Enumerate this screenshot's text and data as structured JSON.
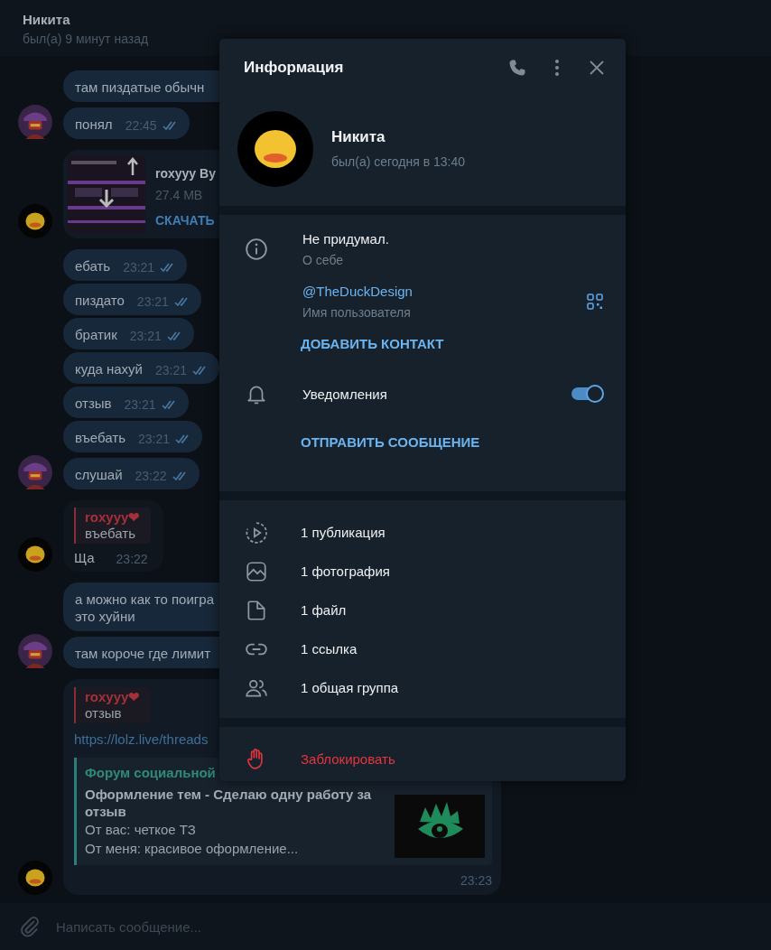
{
  "chat_header": {
    "name": "Никита",
    "status": "был(а) 9 минут назад"
  },
  "messages": [
    {
      "kind": "text",
      "text": "там пиздатые обычн"
    },
    {
      "kind": "text",
      "avatar": {
        "kind": "figure"
      },
      "text": "понял",
      "time": "22:45",
      "read": true
    },
    {
      "kind": "file",
      "avatar": {
        "kind": "duck"
      },
      "name": "roxyyy By",
      "size": "27.4 MB",
      "action": "СКАЧАТЬ"
    },
    {
      "kind": "text",
      "text": "ебать",
      "time": "23:21",
      "read": true
    },
    {
      "kind": "text",
      "text": "пиздато",
      "time": "23:21",
      "read": true
    },
    {
      "kind": "text",
      "text": "братик",
      "time": "23:21",
      "read": true
    },
    {
      "kind": "text",
      "text": "куда нахуй",
      "time": "23:21",
      "read": true
    },
    {
      "kind": "text",
      "text": "отзыв",
      "time": "23:21",
      "read": true
    },
    {
      "kind": "text",
      "text": "въебать",
      "time": "23:21",
      "read": true
    },
    {
      "kind": "text",
      "avatar": {
        "kind": "figure"
      },
      "text": "слушай",
      "time": "23:22",
      "read": true
    },
    {
      "kind": "reply",
      "avatar": {
        "kind": "duck"
      },
      "quote_author": "roxyyy❤",
      "quote_text": "въебать",
      "text": "Ща",
      "time": "23:22"
    },
    {
      "kind": "text",
      "text": "а можно как то поигра\nэто хуйни"
    },
    {
      "kind": "text",
      "avatar": {
        "kind": "figure"
      },
      "text": "там короче где лимит"
    },
    {
      "kind": "link",
      "avatar": {
        "kind": "duck"
      },
      "quote_author": "roxyyy❤",
      "quote_text": "отзыв",
      "url": "https://lolz.live/threads",
      "preview": {
        "site": "Форум социальной",
        "title": "Оформление тем - Сделаю одну работу за отзыв",
        "lines": [
          "От вас: четкое ТЗ",
          "От меня: красивое оформление..."
        ]
      },
      "time": "23:23"
    }
  ],
  "composer": {
    "placeholder": "Написать сообщение..."
  },
  "info_panel": {
    "title": "Информация",
    "name": "Никита",
    "status": "был(а) сегодня в 13:40",
    "bio": {
      "value": "Не придумал.",
      "label": "О себе"
    },
    "username": {
      "value": "@TheDuckDesign",
      "label": "Имя пользователя"
    },
    "add_contact": "ДОБАВИТЬ КОНТАКТ",
    "notifications": {
      "label": "Уведомления",
      "on": true
    },
    "send_message": "ОТПРАВИТЬ СООБЩЕНИЕ",
    "media": [
      {
        "kind": "posts",
        "label": "1 публикация"
      },
      {
        "kind": "photos",
        "label": "1 фотография"
      },
      {
        "kind": "files",
        "label": "1 файл"
      },
      {
        "kind": "links",
        "label": "1 ссылка"
      },
      {
        "kind": "groups",
        "label": "1 общая группа"
      }
    ],
    "block": "Заблокировать"
  }
}
